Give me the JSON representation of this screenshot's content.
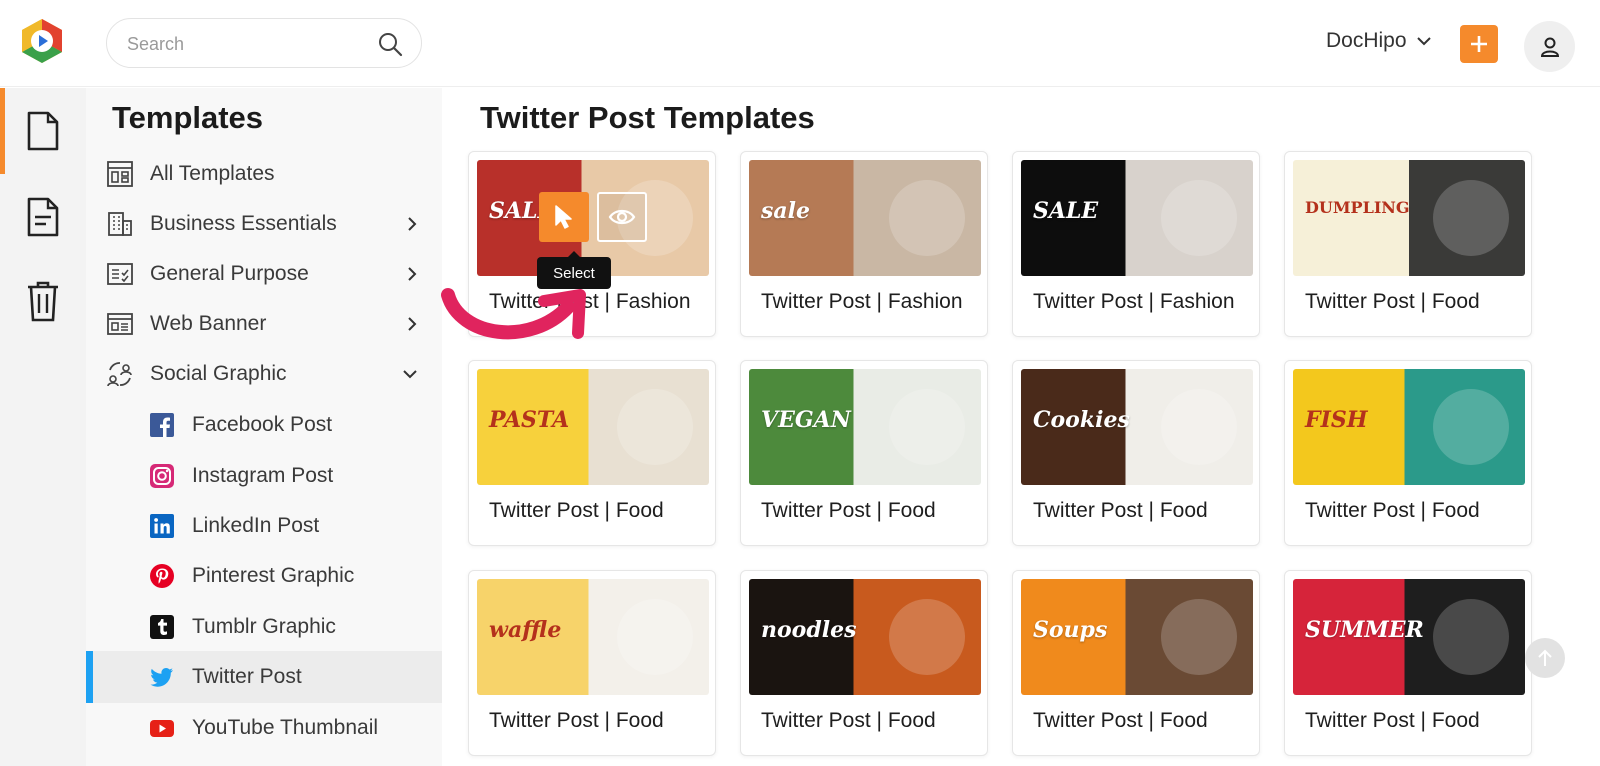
{
  "search": {
    "placeholder": "Search"
  },
  "account": {
    "name": "DocHipo"
  },
  "sidebar": {
    "title": "Templates",
    "items": [
      {
        "label": "All Templates",
        "icon": "layout-icon"
      },
      {
        "label": "Business Essentials",
        "icon": "building-icon"
      },
      {
        "label": "General Purpose",
        "icon": "checklist-icon"
      },
      {
        "label": "Web Banner",
        "icon": "banner-icon"
      },
      {
        "label": "Social Graphic",
        "icon": "social-icon"
      }
    ],
    "social_items": [
      {
        "label": "Facebook Post",
        "icon": "facebook-icon"
      },
      {
        "label": "Instagram Post",
        "icon": "instagram-icon"
      },
      {
        "label": "LinkedIn Post",
        "icon": "linkedin-icon"
      },
      {
        "label": "Pinterest Graphic",
        "icon": "pinterest-icon"
      },
      {
        "label": "Tumblr Graphic",
        "icon": "tumblr-icon"
      },
      {
        "label": "Twitter Post",
        "icon": "twitter-icon",
        "active": true
      },
      {
        "label": "YouTube Thumbnail",
        "icon": "youtube-icon"
      }
    ]
  },
  "main": {
    "title": "Twitter Post Templates",
    "tooltip": "Select",
    "templates": [
      {
        "name": "Twitter Post | Fashion",
        "word": "SALE",
        "bg": "#b8302a",
        "accent": "#e8c9a7"
      },
      {
        "name": "Twitter Post | Fashion",
        "word": "sale",
        "bg": "#b57a55",
        "accent": "#c9b7a4"
      },
      {
        "name": "Twitter Post | Fashion",
        "word": "SALE",
        "bg": "#0d0d0d",
        "accent": "#d8d2cc"
      },
      {
        "name": "Twitter Post | Food",
        "word": "DUMPLING",
        "bg": "#f6f0d8",
        "accent": "#3a3a38"
      },
      {
        "name": "Twitter Post | Food",
        "word": "PASTA",
        "bg": "#f7d13c",
        "accent": "#e8e0d2"
      },
      {
        "name": "Twitter Post | Food",
        "word": "VEGAN",
        "bg": "#4d8a3c",
        "accent": "#e9ece6"
      },
      {
        "name": "Twitter Post | Food",
        "word": "Cookies",
        "bg": "#4a2a1a",
        "accent": "#f0eee9"
      },
      {
        "name": "Twitter Post | Food",
        "word": "FISH",
        "bg": "#f3c81d",
        "accent": "#2b9a8a"
      },
      {
        "name": "Twitter Post | Food",
        "word": "waffle",
        "bg": "#f7d36a",
        "accent": "#f3f0ea"
      },
      {
        "name": "Twitter Post | Food",
        "word": "noodles",
        "bg": "#1a1410",
        "accent": "#c85a1e"
      },
      {
        "name": "Twitter Post | Food",
        "word": "Soups",
        "bg": "#f08a1c",
        "accent": "#6a4a34"
      },
      {
        "name": "Twitter Post | Food",
        "word": "SUMMER",
        "bg": "#d6243a",
        "accent": "#1e1e1e"
      }
    ]
  },
  "colors": {
    "accent": "#f58a2c",
    "twitter": "#1da1f2"
  }
}
